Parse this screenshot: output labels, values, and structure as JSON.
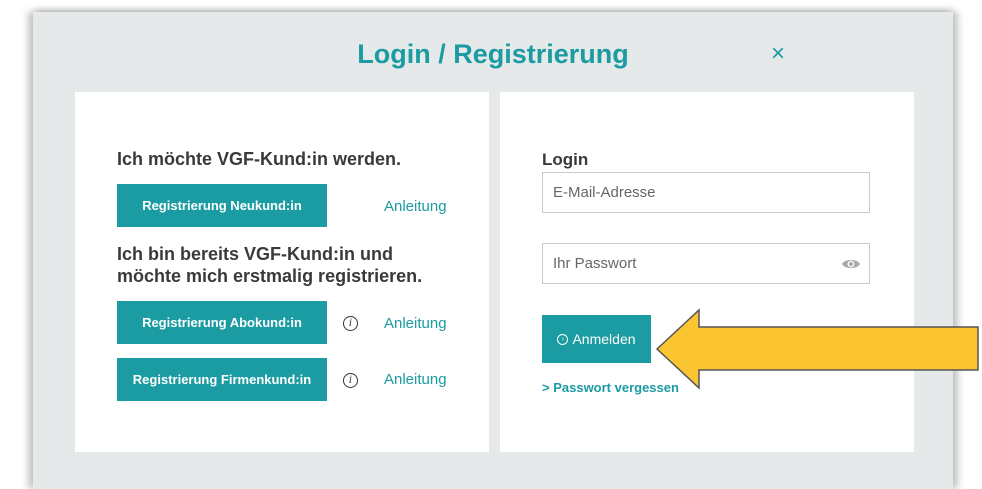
{
  "modal": {
    "title": "Login / Registrierung",
    "close_label": "×"
  },
  "register": {
    "heading_new": "Ich möchte VGF-Kund:in werden.",
    "btn_new_customer": "Registrierung Neukund:in",
    "link_guide_new": "Anleitung",
    "heading_existing_line1": "Ich bin bereits VGF-Kund:in und",
    "heading_existing_line2": "möchte mich erstmalig registrieren.",
    "btn_subscription": "Registrierung Abokund:in",
    "info_glyph": "i",
    "link_guide_subscription": "Anleitung",
    "btn_business": "Registrierung Firmenkund:in",
    "link_guide_business": "Anleitung"
  },
  "login": {
    "heading": "Login",
    "email_placeholder": "E-Mail-Adresse",
    "email_value": "",
    "password_placeholder": "Ihr Passwort",
    "password_value": "",
    "submit_label": "Anmelden",
    "forgot_password": "> Passwort vergessen"
  },
  "colors": {
    "accent": "#1b9ba2",
    "modal_bg": "#e5e9ea",
    "callout_arrow": "#fbc531"
  },
  "icons": {
    "close": "close-icon",
    "info": "info-icon",
    "password_visibility": "eye-icon",
    "submit": "arrow-circle-icon",
    "callout": "arrow-pointer-icon"
  }
}
